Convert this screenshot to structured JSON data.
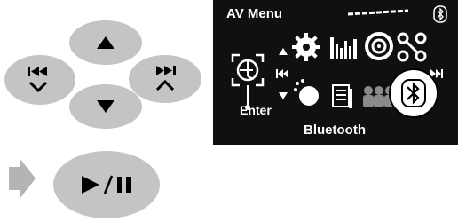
{
  "screen": {
    "title": "AV Menu",
    "enter_label": "Enter",
    "selected_label": "Bluetooth"
  },
  "menu_icons": [
    "settings-gear-icon",
    "equalizer-icon",
    "sound-disc-icon",
    "mode-icon",
    "dimmer-icon",
    "list-icon",
    "users-icon",
    "bluetooth-icon"
  ],
  "buttons": [
    "prev-down-button",
    "up-button",
    "next-up-button",
    "down-button",
    "play-pause-button"
  ],
  "colors": {
    "screen_background": "#101010",
    "button_fill": "#c4c4c4",
    "arrow_fill": "#b4b4b4",
    "symbol": "#000000",
    "screen_text": "#ffffff"
  }
}
